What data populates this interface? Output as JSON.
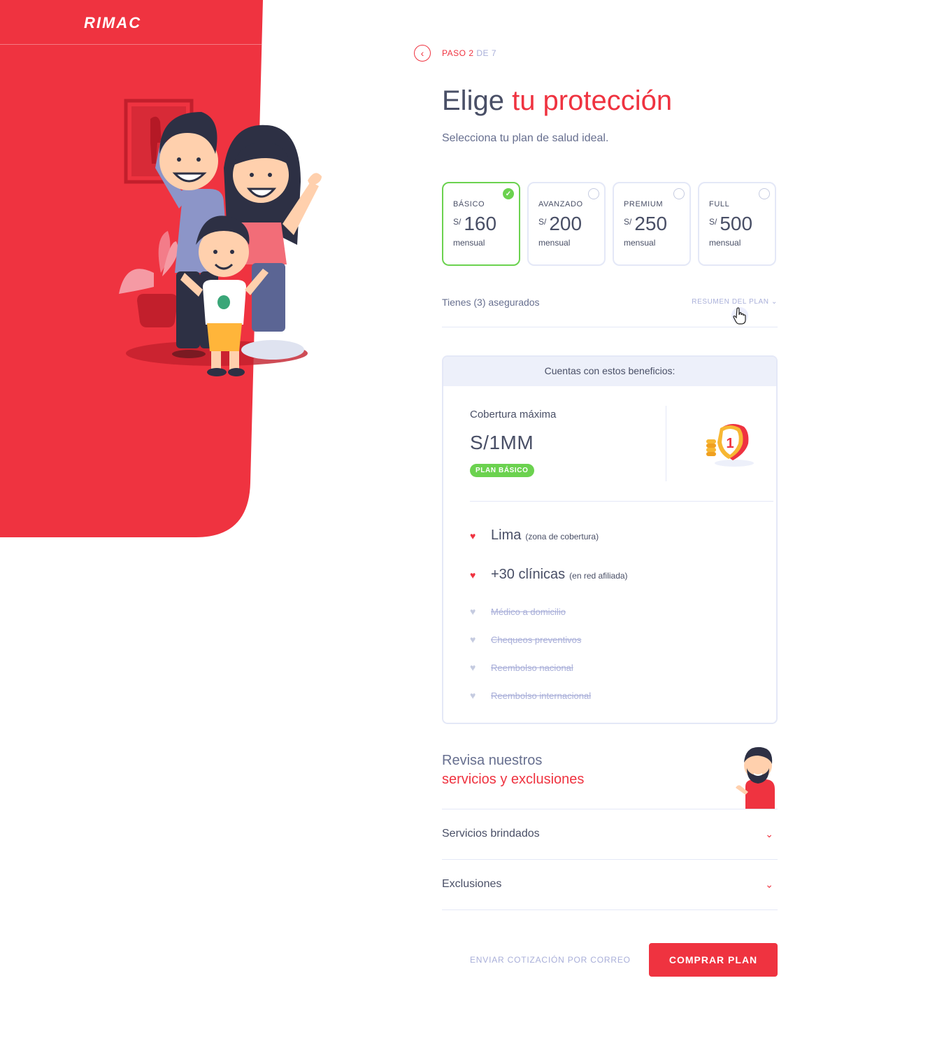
{
  "brand": {
    "logo": "RIMAC",
    "color": "#ef3340"
  },
  "step": {
    "prefix": "PASO",
    "current": "2",
    "separator": "DE",
    "total": "7",
    "back_icon": "chevron-left-icon"
  },
  "header": {
    "title_prefix": "Elige",
    "title_highlight": "tu protección",
    "subtitle": "Selecciona tu plan de salud ideal."
  },
  "plans": [
    {
      "name": "BÁSICO",
      "currency": "S/",
      "price": "160",
      "period": "mensual",
      "selected": true
    },
    {
      "name": "AVANZADO",
      "currency": "S/",
      "price": "200",
      "period": "mensual",
      "selected": false
    },
    {
      "name": "PREMIUM",
      "currency": "S/",
      "price": "250",
      "period": "mensual",
      "selected": false
    },
    {
      "name": "FULL",
      "currency": "S/",
      "price": "500",
      "period": "mensual",
      "selected": false
    }
  ],
  "insured": {
    "text": "Tienes (3) asegurados",
    "summary_link": "RESUMEN DEL PLAN"
  },
  "benefits": {
    "header": "Cuentas con estos beneficios:",
    "coverage_label": "Cobertura máxima",
    "coverage_amount": "S/1MM",
    "plan_badge": "PLAN BÁSICO",
    "shield_number": "1",
    "active": [
      {
        "main": "Lima",
        "sub": "(zona de cobertura)"
      },
      {
        "main": "+30 clínicas",
        "sub": "(en red afiliada)"
      }
    ],
    "inactive": [
      {
        "main": "Médico a domicilio"
      },
      {
        "main": "Chequeos preventivos"
      },
      {
        "main": "Reembolso nacional"
      },
      {
        "main": "Reembolso internacional"
      }
    ]
  },
  "review": {
    "line1": "Revisa nuestros",
    "line2": "servicios y exclusiones"
  },
  "accordions": [
    {
      "label": "Servicios brindados"
    },
    {
      "label": "Exclusiones"
    }
  ],
  "actions": {
    "email_label": "ENVIAR COTIZACIÓN POR CORREO",
    "buy_label": "COMPRAR PLAN"
  }
}
